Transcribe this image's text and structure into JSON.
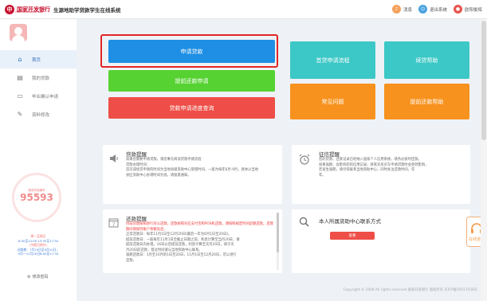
{
  "header": {
    "logo_mark": "中",
    "bank_name": "国家开发银行",
    "bank_name_en": "CHINA DEVELOPMENT BANK",
    "system_title": "生源地助学贷款学生在线系统",
    "actions": [
      {
        "label": "消息",
        "icon": "bell-icon",
        "color": "#f5a25d"
      },
      {
        "label": "退出系统",
        "icon": "logout-icon",
        "color": "#4aa3df"
      },
      {
        "label": "欧阳俊辉",
        "icon": "user-icon",
        "color": "#e8544f"
      }
    ]
  },
  "sidebar": {
    "items": [
      {
        "label": "首页",
        "icon": "⌂",
        "active": true
      },
      {
        "label": "我的贷款",
        "icon": "▤",
        "active": false
      },
      {
        "label": "毕业确认申请",
        "icon": "▭",
        "active": false
      },
      {
        "label": "资料修改",
        "icon": "✎",
        "active": false
      }
    ],
    "gauge": {
      "label": "服务热线编号",
      "number": "95593"
    },
    "info_lines": [
      "周一至周日",
      "8:30至12:00 13:30至17:30",
      "(节假日除外)",
      "还款期：7月15日至9月10日；",
      "9月一12月20日8:00至17:30"
    ],
    "pwd_link": "修改密码"
  },
  "main": {
    "buttons": {
      "apply_loan": "申请贷款",
      "prepay_apply": "提前还款申请",
      "progress_query": "贷款申请进度查询",
      "first_loan_flow": "首贷申请流程",
      "renew_help": "续贷帮助",
      "faq": "常见问题",
      "prepay_help": "提前还款帮助"
    },
    "loan_notice": {
      "title": "贷款提醒",
      "lines": [
        "如果您需要申请贷款，请您事先阅读贷款申请流程",
        "贷款办理时间：",
        "首次或续贷申请的时间为当地县级资助中心受理时间，一般为每年6月-9月，具体以当地",
        "县区资助中心办理时间为准，请留意通知。"
      ]
    },
    "credit_notice": {
      "title": "征信提醒",
      "lines": [
        "您的贷款、还款记录已经纳入国家个人信用系统，请务必按时还款。",
        "如果逾期，会影响您的信用记录，将来买房买车申请贷款时会受到影响，",
        "若发生逾期，请尽快联系当地资助中心，同时关注还款时间，年",
        "年。"
      ]
    },
    "repay_notice": {
      "title": "还款提醒",
      "red_lines": [
        "目前贷款按照进行对公还款，还款按照对应支付宝和POS机还款，请按照规定时间足额还款。还款",
        "期间请保持账户余额充足。"
      ],
      "lines": [
        "正常还款日：每年11月1日至12月20日(最后一年为6月1日至20日)。",
        "提前还款日：一般每年11月1日至截止日期之前，利息计算至当月20日，请",
        "提前还款日内办理。16日以后提前还款，利息计算至次月20日，请于次",
        "月20日前还款，错过时间请与当地资助中心联系。",
        "逾期还款日：1月至10月的1日至20日，11月1日至12月20日，可以进行",
        "还款。"
      ]
    },
    "contact": {
      "title": "本人所属资助中心联系方式",
      "button": "查看"
    },
    "float_help": "在线咨询",
    "footer": "Copyright © 2009 All rights reserved 国家开发银行 版权所有 京ICP备05017038号"
  }
}
